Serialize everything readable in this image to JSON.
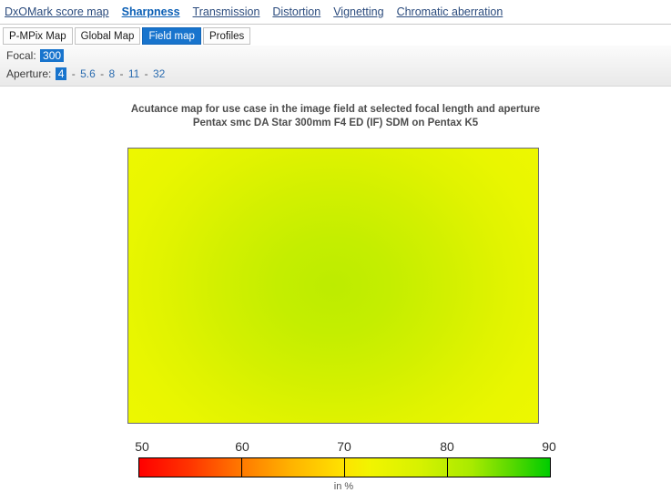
{
  "topnav": {
    "items": [
      {
        "label": "DxOMark score map",
        "active": false
      },
      {
        "label": "Sharpness",
        "active": true
      },
      {
        "label": "Transmission",
        "active": false
      },
      {
        "label": "Distortion",
        "active": false
      },
      {
        "label": "Vignetting",
        "active": false
      },
      {
        "label": "Chromatic aberration",
        "active": false
      }
    ]
  },
  "tabs": [
    {
      "label": "P-MPix Map",
      "selected": false
    },
    {
      "label": "Global Map",
      "selected": false
    },
    {
      "label": "Field map",
      "selected": true
    },
    {
      "label": "Profiles",
      "selected": false
    }
  ],
  "controls": {
    "focal": {
      "label": "Focal:",
      "selected": "300",
      "options": [
        "300"
      ]
    },
    "aperture": {
      "label": "Aperture:",
      "selected": "4",
      "options": [
        "4",
        "5.6",
        "8",
        "11",
        "32"
      ],
      "separator": "-"
    }
  },
  "chart_data": {
    "type": "heatmap",
    "title": "Acutance map for use case in the image field at selected focal length and aperture",
    "subtitle": "Pentax smc DA Star 300mm F4 ED (IF) SDM on Pentax K5",
    "xlabel": "",
    "ylabel": "",
    "colorbar": {
      "label": "in %",
      "min": 50,
      "max": 90,
      "ticks": [
        50,
        60,
        70,
        80,
        90
      ],
      "tick_labels": [
        "50",
        "60",
        "70",
        "80",
        "90"
      ],
      "colors": [
        "#ff0000",
        "#ffb300",
        "#f2f400",
        "#a8ea00",
        "#00cc00"
      ],
      "gradient_stops": [
        {
          "value": 50,
          "color": "#ff0000"
        },
        {
          "value": 55,
          "color": "#ff7a00"
        },
        {
          "value": 60,
          "color": "#ffb300"
        },
        {
          "value": 70,
          "color": "#f2f400"
        },
        {
          "value": 80,
          "color": "#a8ea00"
        },
        {
          "value": 90,
          "color": "#00cc00"
        }
      ]
    },
    "field": {
      "description": "Acutance field map, radial falloff from centre to corners",
      "center_value": 76,
      "corner_value": 72,
      "edge_value": 73,
      "center_color": "#bdec00",
      "corner_color": "#edf700",
      "grid": false
    }
  },
  "colors": {
    "accent": "#1874cd",
    "link": "#2b6cb0",
    "title_text": "#4d4d4d"
  }
}
